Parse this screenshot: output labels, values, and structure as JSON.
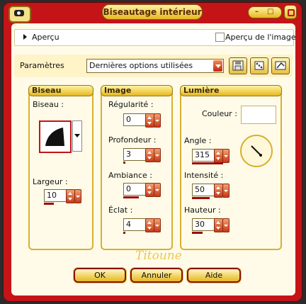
{
  "window": {
    "title": "Biseautage intérieur",
    "minimize_label": "–",
    "maximize_label": "□"
  },
  "preview": {
    "apercu_label": "Aperçu",
    "image_preview_label": "Aperçu de l'image",
    "image_preview_checked": false
  },
  "params": {
    "label": "Paramètres",
    "preset_value": "Dernières options utilisées"
  },
  "biseau": {
    "title": "Biseau",
    "bevel_label": "Biseau :",
    "largeur_label": "Largeur :",
    "largeur_value": "10"
  },
  "image": {
    "title": "Image",
    "regularite_label": "Régularité :",
    "regularite_value": "0",
    "profondeur_label": "Profondeur :",
    "profondeur_value": "3",
    "ambiance_label": "Ambiance :",
    "ambiance_value": "0",
    "eclat_label": "Éclat :",
    "eclat_value": "4"
  },
  "lumiere": {
    "title": "Lumière",
    "couleur_label": "Couleur :",
    "couleur_value": "#ffffff",
    "angle_label": "Angle :",
    "angle_value": "315",
    "intensite_label": "Intensité :",
    "intensite_value": "50",
    "hauteur_label": "Hauteur :",
    "hauteur_value": "30"
  },
  "signature": "Titoune",
  "buttons": {
    "ok": "OK",
    "cancel": "Annuler",
    "help": "Aide"
  },
  "colors": {
    "frame": "#c41418",
    "gold": "#e6b820",
    "panel": "#fffbe8"
  }
}
